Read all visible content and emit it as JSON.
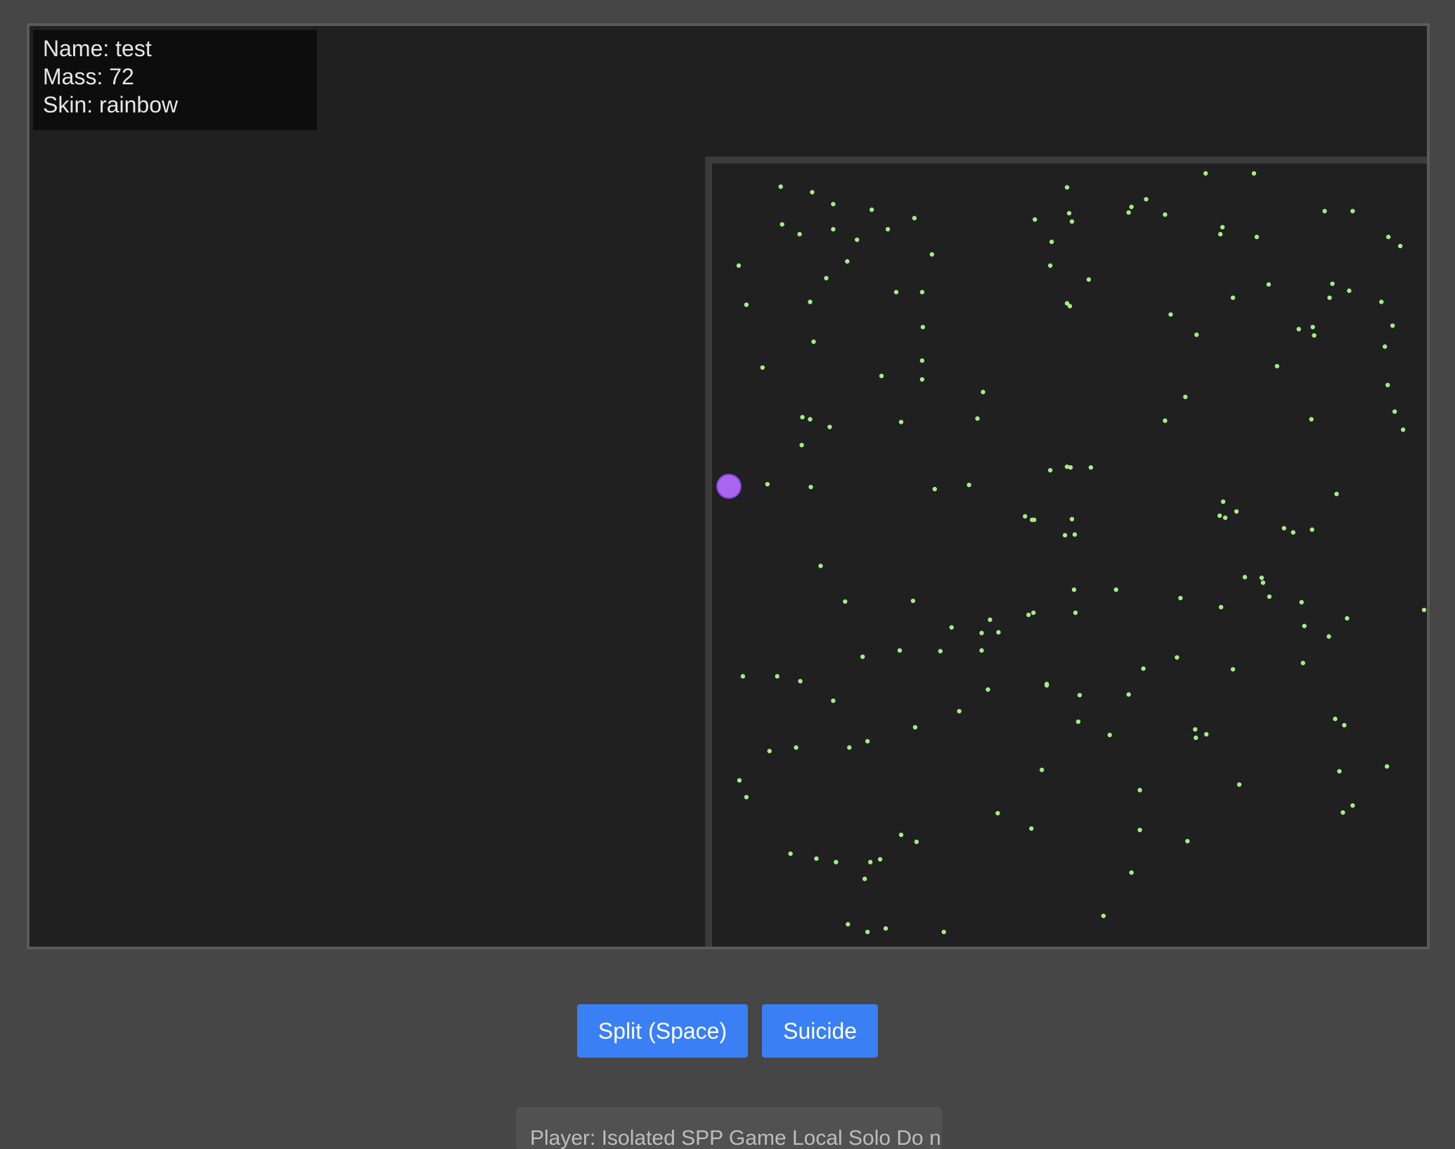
{
  "hud": {
    "name_line": "Name: test",
    "mass_line": "Mass: 72",
    "skin_line": "Skin: rainbow"
  },
  "controls": {
    "split_label": "Split (Space)",
    "suicide_label": "Suicide"
  },
  "info": {
    "text": "Player: Isolated SPP Game Local Solo Do not"
  },
  "colors": {
    "background": "#464646",
    "arena": "#202020",
    "arena_border": "#3b3b3b",
    "food": "#a6ec8a",
    "player": "#a964f0",
    "player_outline": "#8a3fe0",
    "button": "#3a7ff4"
  },
  "player": {
    "name": "test",
    "mass": 72,
    "skin": "rainbow"
  }
}
